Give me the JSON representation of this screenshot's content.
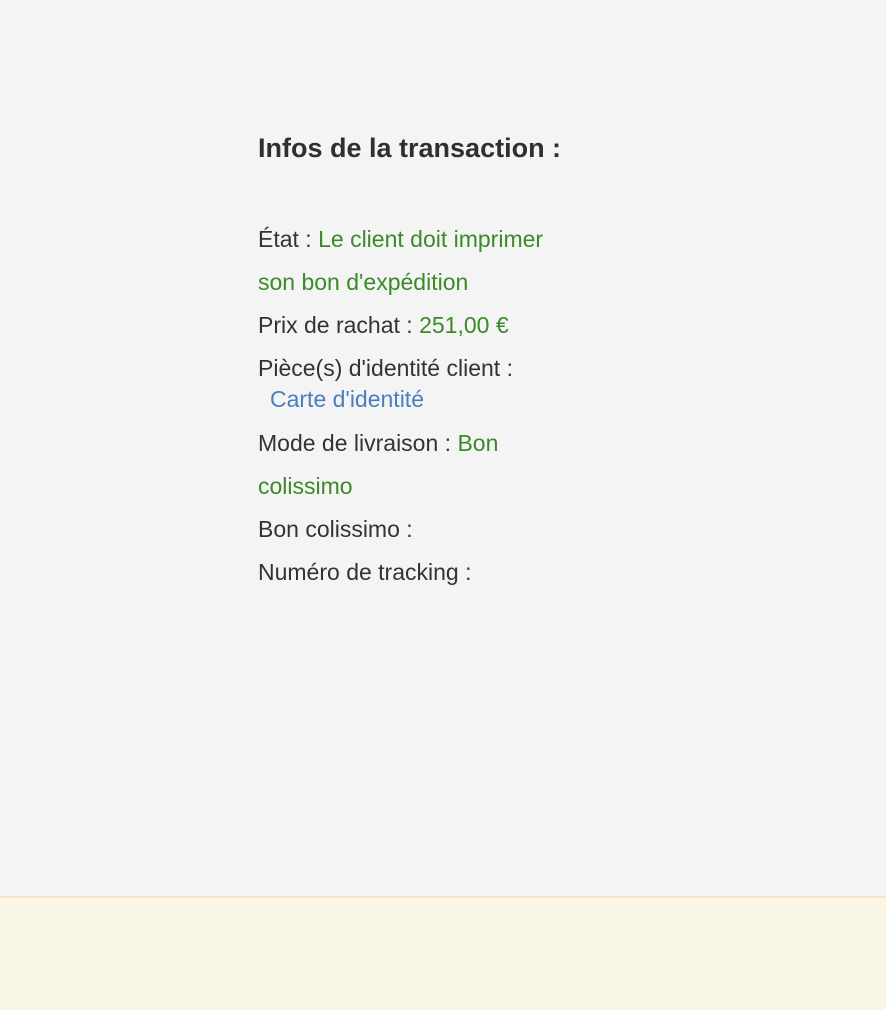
{
  "transaction": {
    "title": "Infos de la transaction :",
    "state_label": "État : ",
    "state_value": "Le client doit imprimer son bon d'expédition",
    "price_label": "Prix de rachat : ",
    "price_value": "251,00 €",
    "id_label": "Pièce(s) d'identité client :",
    "id_link": "Carte d'identité",
    "delivery_label": "Mode de livraison : ",
    "delivery_value": "Bon colissimo",
    "voucher_label": "Bon colissimo :",
    "tracking_label": "Numéro de tracking :"
  },
  "colors": {
    "value": "#3a8a2a",
    "link": "#4a7fbf",
    "footer": "#faf6e6"
  }
}
